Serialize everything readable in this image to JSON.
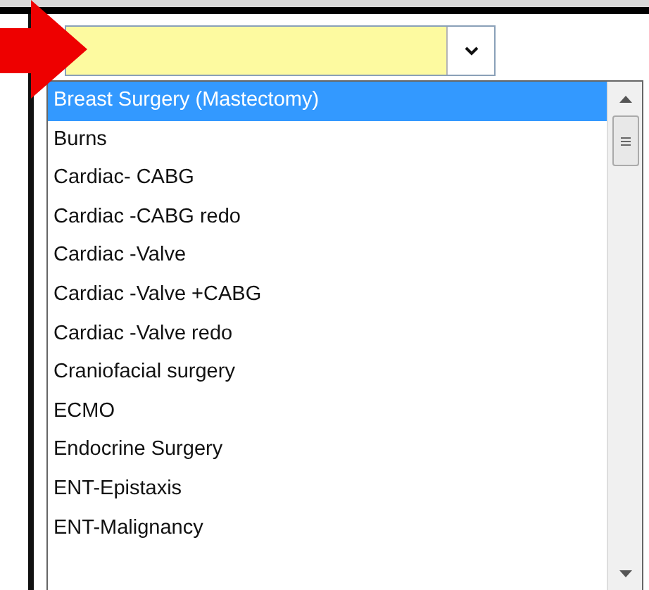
{
  "options": [
    {
      "label": "Breast Surgery (Mastectomy)",
      "selected": true
    },
    {
      "label": "Burns",
      "selected": false
    },
    {
      "label": "Cardiac- CABG",
      "selected": false
    },
    {
      "label": "Cardiac -CABG redo",
      "selected": false
    },
    {
      "label": "Cardiac -Valve",
      "selected": false
    },
    {
      "label": "Cardiac -Valve +CABG",
      "selected": false
    },
    {
      "label": "Cardiac -Valve redo",
      "selected": false
    },
    {
      "label": "Craniofacial surgery",
      "selected": false
    },
    {
      "label": "ECMO",
      "selected": false
    },
    {
      "label": "Endocrine Surgery",
      "selected": false
    },
    {
      "label": "ENT-Epistaxis",
      "selected": false
    },
    {
      "label": "ENT-Malignancy",
      "selected": false
    }
  ]
}
